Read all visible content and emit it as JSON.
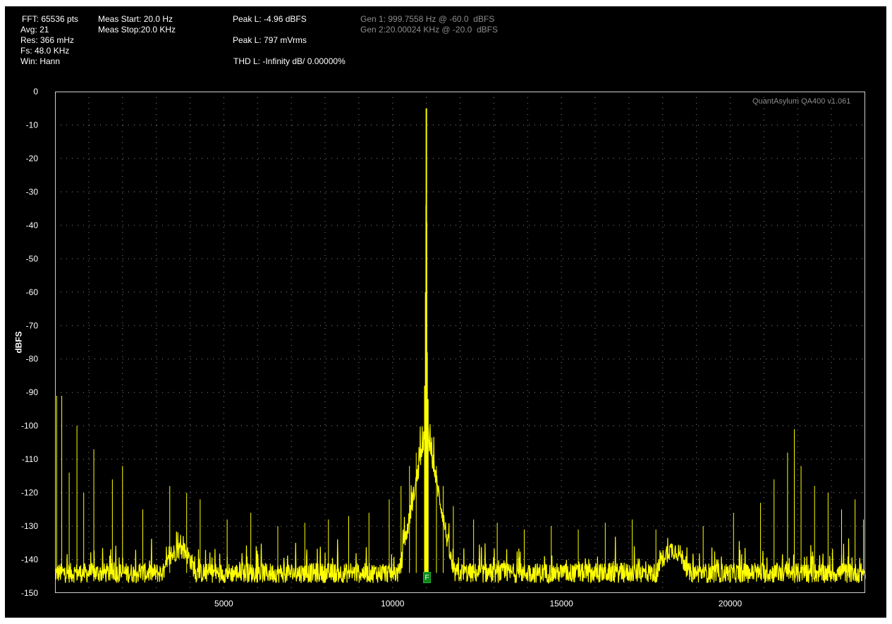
{
  "info": {
    "fft": "FFT: 65536 pts",
    "avg": "Avg: 21",
    "res": "Res: 366 mHz",
    "fs": "Fs: 48.0 KHz",
    "win": "Win: Hann",
    "meas_start": "Meas Start: 20.0 Hz",
    "meas_stop": "Meas Stop:20.0 KHz",
    "peak_dbfs": "Peak L: -4.96 dBFS",
    "peak_vrms": "Peak L: 797 mVrms",
    "thd": "THD L: -Infinity dB/ 0.00000%",
    "gen1": "Gen 1: 999.7558 Hz @ -60.0  dBFS",
    "gen2": "Gen 2:20.00024 KHz @ -20.0  dBFS"
  },
  "watermark": "QuantAsylum QA400 v1.061",
  "marker_label": "F",
  "colors": {
    "background": "#000000",
    "trace": "#ffff00",
    "grid": "#8a8a8a",
    "marker": "#0b8a1a"
  },
  "chart_data": {
    "type": "line",
    "xlim": [
      0,
      24000
    ],
    "ylim": [
      -150,
      0
    ],
    "ylabel": "dBFS",
    "xlabel": "",
    "x_ticks": [
      "5000",
      "10000",
      "15000",
      "20000"
    ],
    "y_ticks": [
      "0",
      "-10",
      "-20",
      "-30",
      "-40",
      "-50",
      "-60",
      "-70",
      "-80",
      "-90",
      "-100",
      "-110",
      "-120",
      "-130",
      "-140",
      "-150"
    ],
    "grid": true,
    "noise_floor_db": -144,
    "main_peak": {
      "x": 11000,
      "y": -5
    },
    "near_peak_lines": [
      {
        "x": 10990,
        "y": -34
      },
      {
        "x": 11010,
        "y": -39
      },
      {
        "x": 10975,
        "y": -60
      },
      {
        "x": 11025,
        "y": -78
      },
      {
        "x": 10950,
        "y": -88
      },
      {
        "x": 11050,
        "y": -92
      }
    ],
    "noise_bumps": [
      {
        "x": 3700,
        "y": -137
      },
      {
        "x": 18300,
        "y": -137
      }
    ],
    "spurs": [
      {
        "x": 50,
        "y": -91
      },
      {
        "x": 200,
        "y": -91
      },
      {
        "x": 420,
        "y": -114
      },
      {
        "x": 650,
        "y": -100
      },
      {
        "x": 850,
        "y": -120
      },
      {
        "x": 1150,
        "y": -107
      },
      {
        "x": 1700,
        "y": -116
      },
      {
        "x": 2000,
        "y": -112
      },
      {
        "x": 2600,
        "y": -125
      },
      {
        "x": 3400,
        "y": -118
      },
      {
        "x": 3900,
        "y": -120
      },
      {
        "x": 4300,
        "y": -122
      },
      {
        "x": 5100,
        "y": -128
      },
      {
        "x": 5800,
        "y": -126
      },
      {
        "x": 6600,
        "y": -130
      },
      {
        "x": 7400,
        "y": -129
      },
      {
        "x": 8100,
        "y": -128
      },
      {
        "x": 8700,
        "y": -127
      },
      {
        "x": 9300,
        "y": -126
      },
      {
        "x": 9900,
        "y": -122
      },
      {
        "x": 10250,
        "y": -118
      },
      {
        "x": 10500,
        "y": -112
      },
      {
        "x": 10700,
        "y": -108
      },
      {
        "x": 11300,
        "y": -112
      },
      {
        "x": 11500,
        "y": -118
      },
      {
        "x": 11800,
        "y": -124
      },
      {
        "x": 12400,
        "y": -128
      },
      {
        "x": 13100,
        "y": -129
      },
      {
        "x": 13900,
        "y": -131
      },
      {
        "x": 14700,
        "y": -130
      },
      {
        "x": 15500,
        "y": -131
      },
      {
        "x": 16300,
        "y": -129
      },
      {
        "x": 17100,
        "y": -128
      },
      {
        "x": 17800,
        "y": -131
      },
      {
        "x": 19200,
        "y": -130
      },
      {
        "x": 20100,
        "y": -126
      },
      {
        "x": 20900,
        "y": -123
      },
      {
        "x": 21300,
        "y": -116
      },
      {
        "x": 21700,
        "y": -108
      },
      {
        "x": 21900,
        "y": -101
      },
      {
        "x": 22100,
        "y": -112
      },
      {
        "x": 22500,
        "y": -118
      },
      {
        "x": 22900,
        "y": -120
      },
      {
        "x": 23300,
        "y": -125
      },
      {
        "x": 23700,
        "y": -122
      },
      {
        "x": 23950,
        "y": -128
      }
    ]
  }
}
